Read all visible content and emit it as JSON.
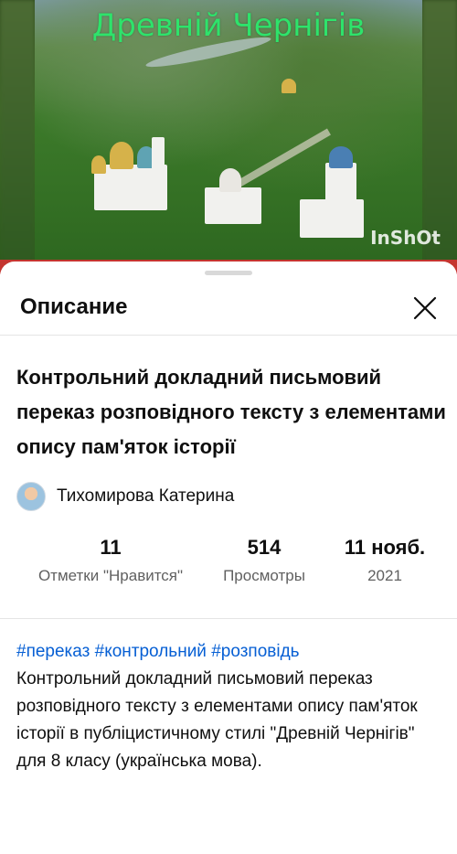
{
  "video": {
    "overlay_title": "Древній Чернігів",
    "watermark": "InShOt"
  },
  "sheet": {
    "title": "Описание",
    "close_icon": "close-icon"
  },
  "details": {
    "heading": "Контрольний докладний письмовий переказ розповідного тексту з елементами опису пам'яток історії",
    "channel_name": "Тихомирова Катерина",
    "stats": [
      {
        "value": "11",
        "label": "Отметки \"Нравится\""
      },
      {
        "value": "514",
        "label": "Просмотры"
      },
      {
        "value": "11 нояб.",
        "label": "2021"
      }
    ],
    "hashtags": [
      "#переказ",
      "#контрольний",
      "#розповідь"
    ],
    "description": "Контрольний докладний письмовий переказ розповідного тексту з елементами опису пам'яток історії в публіцистичному стилі \"Древній Чернігів\" для 8 класу (українська мова)."
  },
  "colors": {
    "accent_link": "#065fd4",
    "overlay_title": "#2ee36b"
  }
}
